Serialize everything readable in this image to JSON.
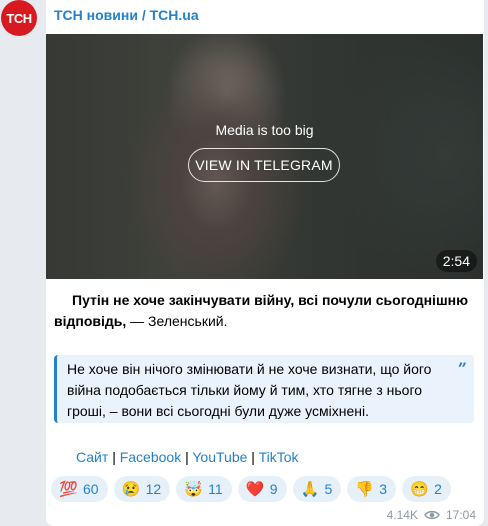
{
  "channel": {
    "avatar_text": "ТСН",
    "name": "ТСН новини / TCH.ua"
  },
  "media": {
    "message": "Media is too big",
    "button_label": "VIEW IN TELEGRAM",
    "duration": "2:54"
  },
  "caption": {
    "bold_text": "Путін не хоче закінчувати війну, всі почули сьогоднішню відповідь,",
    "rest_text": " — Зеленський."
  },
  "quote": {
    "text": "Не хоче він нічого змінювати й не хоче визнати, що його війна подобається тільки йому й тим, хто тягне з нього гроші, – вони всі сьогодні були дуже усміхнені.",
    "mark": "”"
  },
  "links": [
    {
      "label": "Сайт"
    },
    {
      "label": "Facebook"
    },
    {
      "label": "YouTube"
    },
    {
      "label": "TikTok"
    }
  ],
  "link_separator": "|",
  "reactions": [
    {
      "emoji": "💯",
      "count": "60"
    },
    {
      "emoji": "😢",
      "count": "12"
    },
    {
      "emoji": "🤯",
      "count": "11"
    },
    {
      "emoji": "❤️",
      "count": "9"
    },
    {
      "emoji": "🙏",
      "count": "5"
    },
    {
      "emoji": "👎",
      "count": "3"
    },
    {
      "emoji": "😁",
      "count": "2"
    }
  ],
  "meta": {
    "views": "4.14K",
    "time": "17:04"
  },
  "colors": {
    "accent": "#2481cc",
    "avatar_bg": "#d71920",
    "background": "#e7ebf0"
  }
}
